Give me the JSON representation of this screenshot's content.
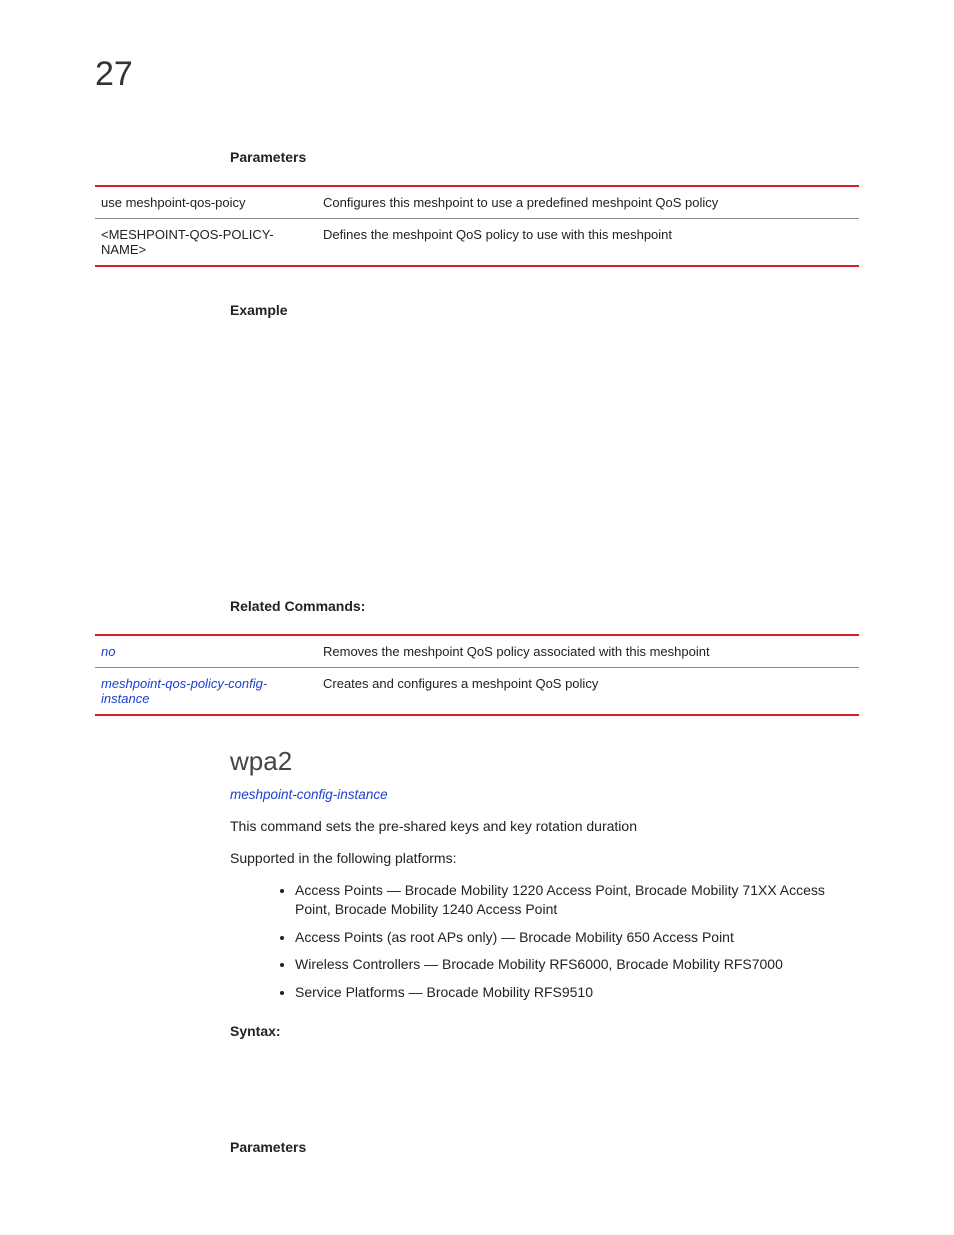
{
  "chapter": "27",
  "sections": {
    "parameters1": "Parameters",
    "example": "Example",
    "related": "Related Commands:",
    "syntax": "Syntax:",
    "parameters2": "Parameters"
  },
  "paramTable": [
    {
      "left": "use meshpoint-qos-poicy",
      "right": "Configures this meshpoint to use a predefined meshpoint QoS policy"
    },
    {
      "left": "<MESHPOINT-QOS-POLICY-NAME>",
      "right": "Defines the meshpoint QoS policy to use with this meshpoint"
    }
  ],
  "relatedTable": [
    {
      "left": "no",
      "right": "Removes the meshpoint QoS policy associated with this meshpoint"
    },
    {
      "left": "meshpoint-qos-policy-config-instance",
      "right": "Creates and configures a meshpoint QoS policy"
    }
  ],
  "wpa2": {
    "title": "wpa2",
    "link": "meshpoint-config-instance",
    "desc": "This command sets the pre-shared keys and key rotation duration",
    "supportedIntro": "Supported in the following platforms:",
    "platforms": [
      "Access Points — Brocade Mobility 1220 Access Point, Brocade Mobility 71XX Access Point, Brocade Mobility 1240 Access Point",
      "Access Points (as root APs only) — Brocade Mobility 650 Access Point",
      "Wireless Controllers — Brocade Mobility RFS6000, Brocade Mobility RFS7000",
      "Service Platforms — Brocade Mobility RFS9510"
    ]
  }
}
